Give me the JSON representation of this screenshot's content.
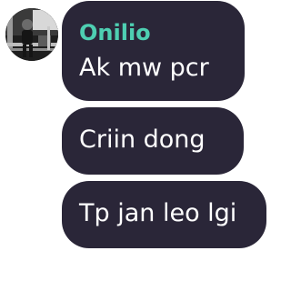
{
  "chat": {
    "sender_name": "Onilio",
    "messages": [
      {
        "text": "Ak mw pcr"
      },
      {
        "text": "Criin dong"
      },
      {
        "text": "Tp jan leo lgi"
      }
    ]
  },
  "colors": {
    "bubble_background": "#2a2638",
    "sender_name_color": "#4ecfb2",
    "message_text_color": "#ffffff"
  },
  "icons": {
    "avatar": "user-profile-photo"
  }
}
